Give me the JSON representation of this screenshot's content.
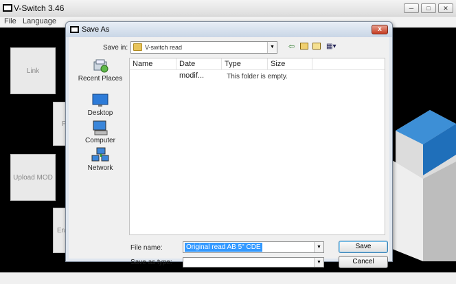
{
  "app": {
    "title": "V-Switch 3.46",
    "menu": [
      "File",
      "Language"
    ],
    "side_buttons": [
      "Link",
      "F",
      "Upload MOD",
      "Era"
    ],
    "window_controls": [
      "minimize-icon",
      "restore-icon",
      "close-icon"
    ]
  },
  "dialog": {
    "title": "Save As",
    "close_glyph": "x",
    "save_in_label": "Save in:",
    "save_in_value": "V-switch read",
    "toolbar_icons": [
      "back-icon",
      "up-folder-icon",
      "new-folder-icon",
      "view-menu-icon"
    ],
    "places": [
      {
        "label": "Recent Places",
        "icon": "recent-places-icon"
      },
      {
        "label": "Desktop",
        "icon": "desktop-icon"
      },
      {
        "label": "Computer",
        "icon": "computer-icon"
      },
      {
        "label": "Network",
        "icon": "network-icon"
      }
    ],
    "columns": [
      "Name",
      "Date modif...",
      "Type",
      "Size"
    ],
    "empty_message": "This folder is empty.",
    "file_name_label": "File name:",
    "file_name_value": "Original read AB 5\" CDE",
    "save_type_label": "Save as type:",
    "save_type_value": "",
    "save_button": "Save",
    "cancel_button": "Cancel"
  },
  "colors": {
    "selection": "#3399ff",
    "dialog_frame": "#dfe6ef",
    "close_button": "#c53b21",
    "app_background": "#000000"
  }
}
